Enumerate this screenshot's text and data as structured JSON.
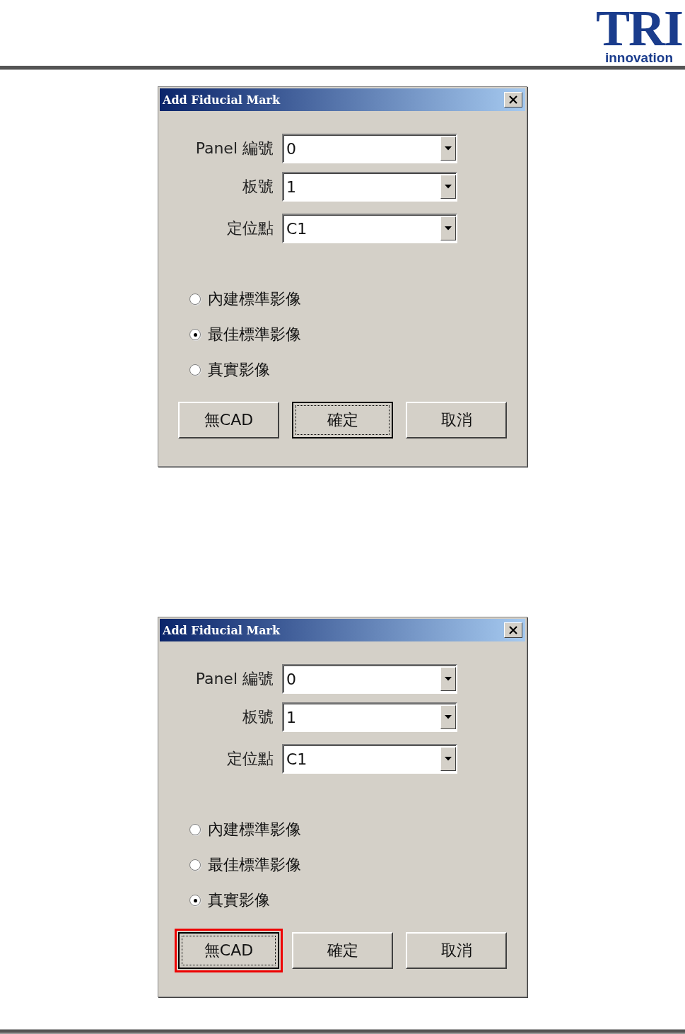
{
  "header": {
    "logo": {
      "mark": "TRI",
      "tagline": "innovation"
    }
  },
  "dialogs": [
    {
      "title": "Add Fiducial Mark",
      "fields": [
        {
          "label": "Panel 編號",
          "value": "0"
        },
        {
          "label": "板號",
          "value": "1"
        },
        {
          "label": "定位點",
          "value": "C1"
        }
      ],
      "options": [
        {
          "label": "內建標準影像",
          "selected": false
        },
        {
          "label": "最佳標準影像",
          "selected": true
        },
        {
          "label": "真實影像",
          "selected": false
        }
      ],
      "buttons": [
        {
          "label": "無CAD",
          "focused": false,
          "highlighted": false
        },
        {
          "label": "確定",
          "focused": true,
          "highlighted": false
        },
        {
          "label": "取消",
          "focused": false,
          "highlighted": false
        }
      ]
    },
    {
      "title": "Add Fiducial Mark",
      "fields": [
        {
          "label": "Panel 編號",
          "value": "0"
        },
        {
          "label": "板號",
          "value": "1"
        },
        {
          "label": "定位點",
          "value": "C1"
        }
      ],
      "options": [
        {
          "label": "內建標準影像",
          "selected": false
        },
        {
          "label": "最佳標準影像",
          "selected": false
        },
        {
          "label": "真實影像",
          "selected": true
        }
      ],
      "buttons": [
        {
          "label": "無CAD",
          "focused": true,
          "highlighted": true
        },
        {
          "label": "確定",
          "focused": false,
          "highlighted": false
        },
        {
          "label": "取消",
          "focused": false,
          "highlighted": false
        }
      ]
    }
  ]
}
